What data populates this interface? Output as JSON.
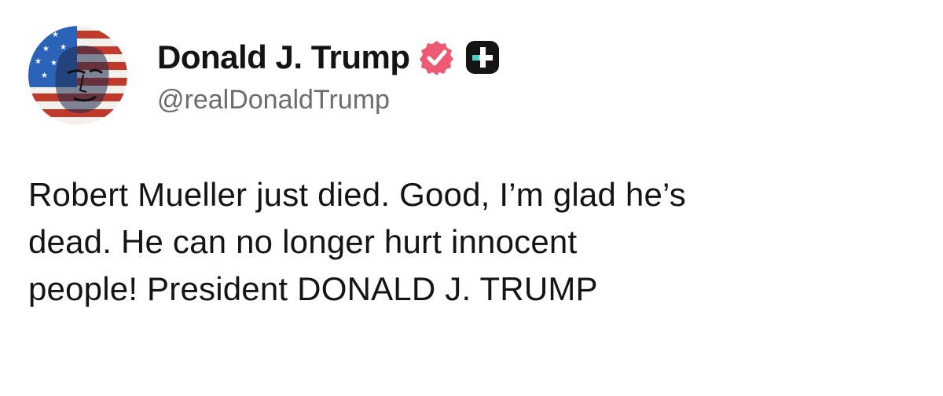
{
  "author": {
    "display_name": "Donald J. Trump",
    "handle": "@realDonaldTrump",
    "avatar_icon": "flag-portrait-avatar",
    "verified_icon": "verified-badge-icon",
    "plus_icon": "plus-badge-icon"
  },
  "post": {
    "lines": [
      "Robert Mueller just died. Good, I’m glad he’s",
      "dead. He can no longer hurt innocent",
      "people! President DONALD J. TRUMP"
    ]
  },
  "colors": {
    "verified_badge": "#ec5b73",
    "plus_badge_bg": "#141414",
    "plus_badge_accent": "#3fd4c4",
    "handle_text": "#6c6c70",
    "flag_red": "#c0392b",
    "flag_blue": "#2b63b8"
  }
}
